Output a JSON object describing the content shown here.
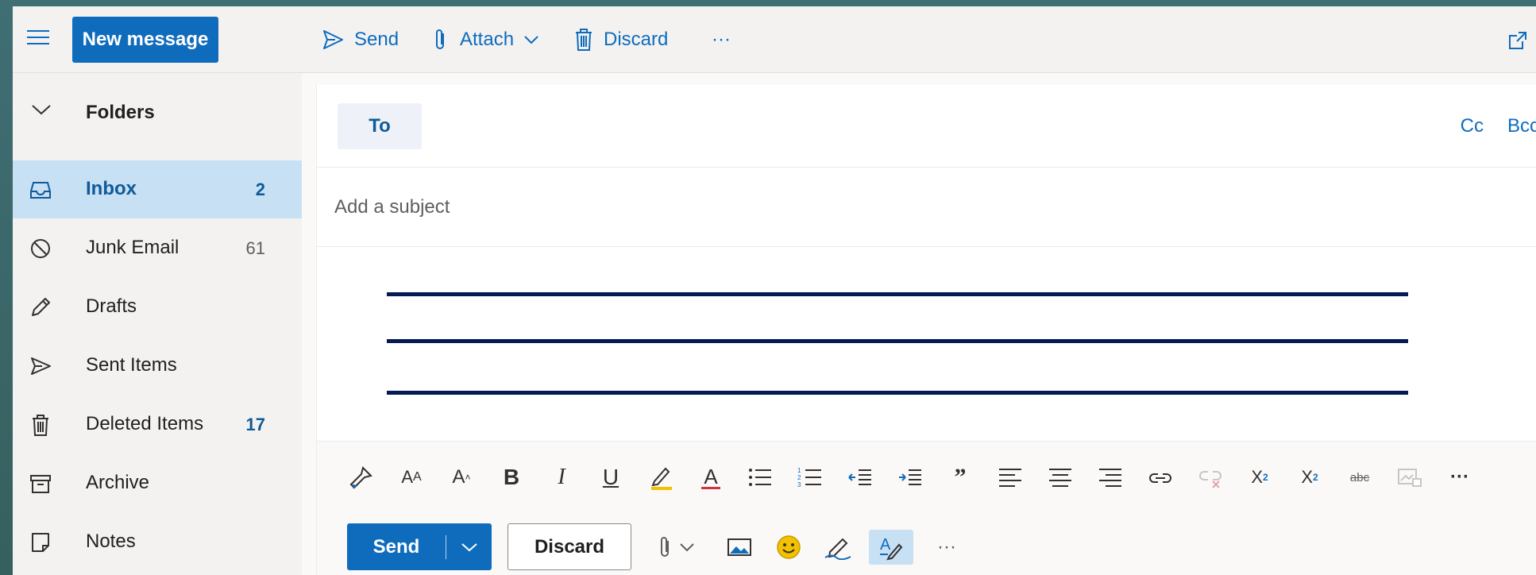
{
  "header": {
    "new_message": "New message",
    "send": "Send",
    "attach": "Attach",
    "discard": "Discard",
    "more": "···"
  },
  "sidebar": {
    "folders_title": "Folders",
    "items": [
      {
        "label": "Inbox",
        "count": "2",
        "icon": "inbox-icon"
      },
      {
        "label": "Junk Email",
        "count": "61",
        "icon": "blocked-icon"
      },
      {
        "label": "Drafts",
        "count": "",
        "icon": "pencil-icon"
      },
      {
        "label": "Sent Items",
        "count": "",
        "icon": "send-icon"
      },
      {
        "label": "Deleted Items",
        "count": "17",
        "icon": "trash-icon"
      },
      {
        "label": "Archive",
        "count": "",
        "icon": "archive-icon"
      },
      {
        "label": "Notes",
        "count": "",
        "icon": "note-icon"
      }
    ]
  },
  "compose": {
    "to_label": "To",
    "cc": "Cc",
    "bcc": "Bcc",
    "subject_placeholder": "Add a subject",
    "subject_value": "",
    "send": "Send",
    "discard": "Discard",
    "more": "···"
  },
  "colors": {
    "accent": "#0f6cbd",
    "selected_bg": "#c7e0f4",
    "rule_lines": "#041a52"
  }
}
